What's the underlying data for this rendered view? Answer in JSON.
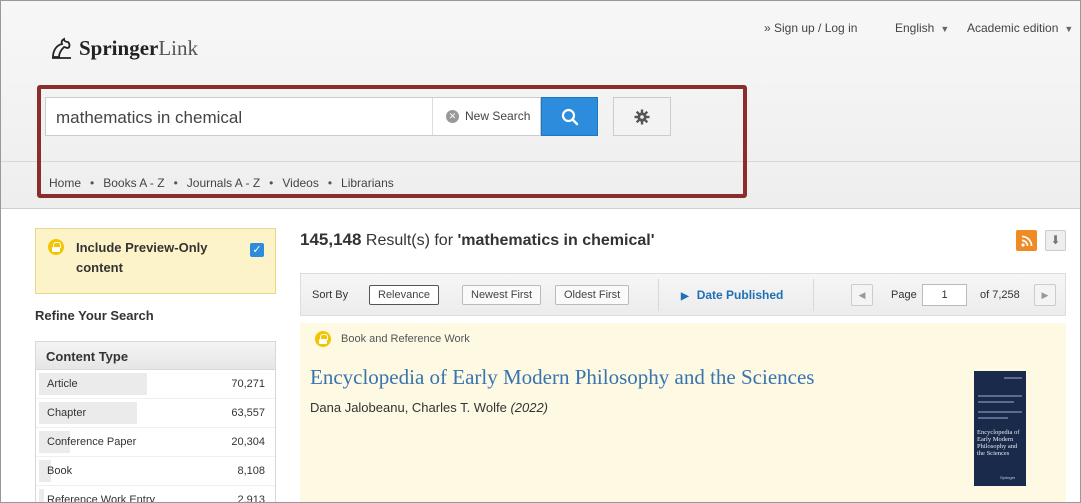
{
  "header": {
    "logo_bold": "Springer",
    "logo_light": "Link",
    "signup_link": "» Sign up / Log in",
    "language": "English",
    "edition": "Academic edition"
  },
  "search": {
    "query": "mathematics in chemical",
    "new_search_label": "New Search"
  },
  "nav": {
    "items": [
      "Home",
      "Books A - Z",
      "Journals A - Z",
      "Videos",
      "Librarians"
    ],
    "separator": "•"
  },
  "sidebar": {
    "preview_label": "Include Preview-Only content",
    "preview_checked": true,
    "refine_title": "Refine Your Search",
    "content_type_title": "Content Type",
    "content_types": [
      {
        "name": "Article",
        "count": "70,271",
        "share": 0.45
      },
      {
        "name": "Chapter",
        "count": "63,557",
        "share": 0.41
      },
      {
        "name": "Conference Paper",
        "count": "20,304",
        "share": 0.13
      },
      {
        "name": "Book",
        "count": "8,108",
        "share": 0.05
      },
      {
        "name": "Reference Work Entry",
        "count": "2,913",
        "share": 0.02
      }
    ]
  },
  "results": {
    "count": "145,148",
    "label": "Result(s) for",
    "query_quoted": "'mathematics in chemical'",
    "sort_by_label": "Sort By",
    "sort_options": [
      "Relevance",
      "Newest First",
      "Oldest First"
    ],
    "date_published_label": "Date Published",
    "page_label": "Page",
    "current_page": "1",
    "page_total": "of 7,258",
    "items": [
      {
        "type": "Book and Reference Work",
        "title": "Encyclopedia of Early Modern Philosophy and the Sciences",
        "authors": "Dana Jalobeanu, Charles T. Wolfe",
        "year": "(2022)",
        "cover_title": "Encyclopedia of Early Modern Philosophy and the Sciences",
        "cover_publisher": "Springer"
      }
    ]
  },
  "colors": {
    "accent_blue": "#2d8cdc",
    "highlight_border": "#8b2d2d",
    "title_link": "#3874b0",
    "preview_bg": "#fdf3c8",
    "rss_orange": "#f08a24"
  }
}
